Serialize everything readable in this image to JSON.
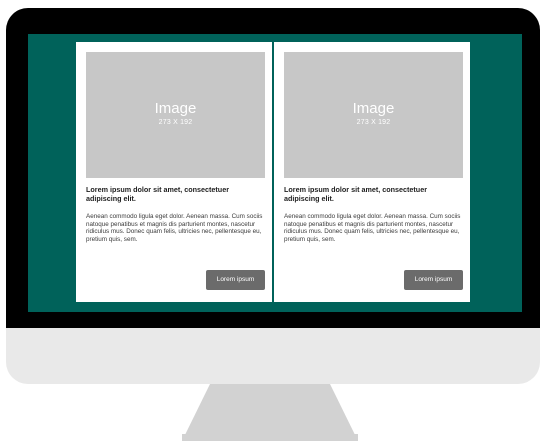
{
  "colors": {
    "screen_background": "#00625a",
    "bezel": "#000000",
    "chin": "#e9e9e9",
    "stand": "#d2d2d2",
    "image_placeholder": "#c7c7c7",
    "button": "#6b6b6b"
  },
  "cards": [
    {
      "image_label": "Image",
      "image_dims": "273 X 192",
      "title": "Lorem ipsum dolor sit amet, consectetuer adipiscing elit.",
      "body": "Aenean commodo ligula eget dolor. Aenean massa. Cum sociis natoque penatibus et magnis dis parturient montes, nascetur ridiculus mus. Donec quam felis, ultricies nec, pellentesque eu, pretium quis, sem.",
      "button_label": "Lorem ipsum"
    },
    {
      "image_label": "Image",
      "image_dims": "273 X 192",
      "title": "Lorem ipsum dolor sit amet, consectetuer adipiscing elit.",
      "body": "Aenean commodo ligula eget dolor. Aenean massa. Cum sociis natoque penatibus et magnis dis parturient montes, nascetur ridiculus mus. Donec quam felis, ultricies nec, pellentesque eu, pretium quis, sem.",
      "button_label": "Lorem ipsum"
    }
  ]
}
